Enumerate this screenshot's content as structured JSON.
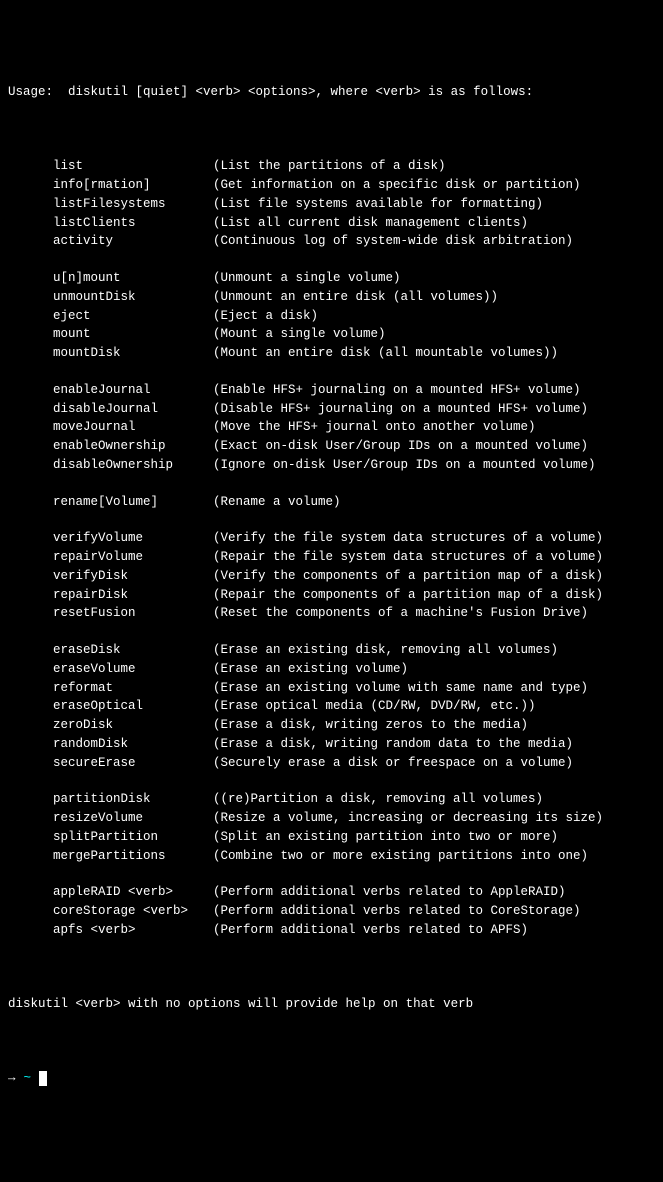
{
  "usage": "Usage:  diskutil [quiet] <verb> <options>, where <verb> is as follows:",
  "sections": [
    {
      "rows": [
        {
          "verb": "list",
          "desc": "(List the partitions of a disk)"
        },
        {
          "verb": "info[rmation]",
          "desc": "(Get information on a specific disk or partition)"
        },
        {
          "verb": "listFilesystems",
          "desc": "(List file systems available for formatting)"
        },
        {
          "verb": "listClients",
          "desc": "(List all current disk management clients)"
        },
        {
          "verb": "activity",
          "desc": "(Continuous log of system-wide disk arbitration)"
        }
      ]
    },
    {
      "rows": [
        {
          "verb": "u[n]mount",
          "desc": "(Unmount a single volume)"
        },
        {
          "verb": "unmountDisk",
          "desc": "(Unmount an entire disk (all volumes))"
        },
        {
          "verb": "eject",
          "desc": "(Eject a disk)"
        },
        {
          "verb": "mount",
          "desc": "(Mount a single volume)"
        },
        {
          "verb": "mountDisk",
          "desc": "(Mount an entire disk (all mountable volumes))"
        }
      ]
    },
    {
      "rows": [
        {
          "verb": "enableJournal",
          "desc": "(Enable HFS+ journaling on a mounted HFS+ volume)"
        },
        {
          "verb": "disableJournal",
          "desc": "(Disable HFS+ journaling on a mounted HFS+ volume)"
        },
        {
          "verb": "moveJournal",
          "desc": "(Move the HFS+ journal onto another volume)"
        },
        {
          "verb": "enableOwnership",
          "desc": "(Exact on-disk User/Group IDs on a mounted volume)"
        },
        {
          "verb": "disableOwnership",
          "desc": "(Ignore on-disk User/Group IDs on a mounted volume)"
        }
      ]
    },
    {
      "rows": [
        {
          "verb": "rename[Volume]",
          "desc": "(Rename a volume)"
        }
      ]
    },
    {
      "rows": [
        {
          "verb": "verifyVolume",
          "desc": "(Verify the file system data structures of a volume)"
        },
        {
          "verb": "repairVolume",
          "desc": "(Repair the file system data structures of a volume)"
        },
        {
          "verb": "verifyDisk",
          "desc": "(Verify the components of a partition map of a disk)"
        },
        {
          "verb": "repairDisk",
          "desc": "(Repair the components of a partition map of a disk)"
        },
        {
          "verb": "resetFusion",
          "desc": "(Reset the components of a machine's Fusion Drive)"
        }
      ]
    },
    {
      "rows": [
        {
          "verb": "eraseDisk",
          "desc": "(Erase an existing disk, removing all volumes)"
        },
        {
          "verb": "eraseVolume",
          "desc": "(Erase an existing volume)"
        },
        {
          "verb": "reformat",
          "desc": "(Erase an existing volume with same name and type)"
        },
        {
          "verb": "eraseOptical",
          "desc": "(Erase optical media (CD/RW, DVD/RW, etc.))"
        },
        {
          "verb": "zeroDisk",
          "desc": "(Erase a disk, writing zeros to the media)"
        },
        {
          "verb": "randomDisk",
          "desc": "(Erase a disk, writing random data to the media)"
        },
        {
          "verb": "secureErase",
          "desc": "(Securely erase a disk or freespace on a volume)"
        }
      ]
    },
    {
      "rows": [
        {
          "verb": "partitionDisk",
          "desc": "((re)Partition a disk, removing all volumes)"
        },
        {
          "verb": "resizeVolume",
          "desc": "(Resize a volume, increasing or decreasing its size)"
        },
        {
          "verb": "splitPartition",
          "desc": "(Split an existing partition into two or more)"
        },
        {
          "verb": "mergePartitions",
          "desc": "(Combine two or more existing partitions into one)"
        }
      ]
    },
    {
      "rows": [
        {
          "verb": "appleRAID <verb>",
          "desc": "(Perform additional verbs related to AppleRAID)"
        },
        {
          "verb": "coreStorage <verb>",
          "desc": "(Perform additional verbs related to CoreStorage)"
        },
        {
          "verb": "apfs <verb>",
          "desc": "(Perform additional verbs related to APFS)"
        }
      ]
    }
  ],
  "footer": "diskutil <verb> with no options will provide help on that verb",
  "prompt": {
    "arrow": "→",
    "tilde": "~"
  }
}
